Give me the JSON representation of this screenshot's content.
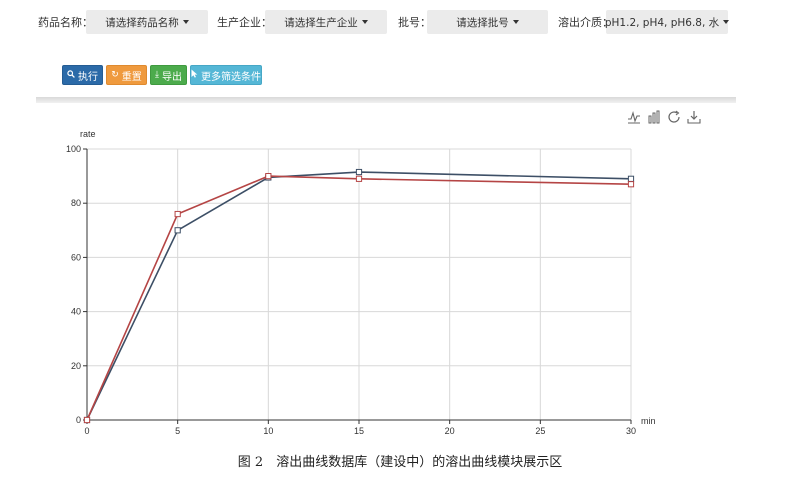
{
  "filters": {
    "drug": {
      "label": "药品名称：",
      "value": "请选择药品名称"
    },
    "company": {
      "label": "生产企业：",
      "value": "请选择生产企业"
    },
    "batch": {
      "label": "批号：",
      "value": "请选择批号"
    },
    "medium": {
      "label": "溶出介质：",
      "value": "pH1.2, pH4, pH6.8, 水"
    }
  },
  "buttons": {
    "execute": "执行",
    "reset": "重置",
    "export": "导出",
    "more_filters": "更多筛选条件"
  },
  "toolbox": {
    "icons": [
      "line-chart-icon",
      "bar-chart-icon",
      "refresh-icon",
      "download-icon"
    ]
  },
  "chart_data": {
    "type": "line",
    "title": "",
    "xlabel": "min",
    "ylabel": "rate",
    "xlim": [
      0,
      30
    ],
    "ylim": [
      0,
      100
    ],
    "x_ticks": [
      0,
      5,
      10,
      15,
      20,
      25,
      30
    ],
    "y_ticks": [
      0,
      20,
      40,
      60,
      80,
      100
    ],
    "grid": true,
    "series": [
      {
        "color": "#3d4f66",
        "x": [
          0,
          5,
          10,
          15,
          30
        ],
        "y": [
          0,
          70,
          89.5,
          91.5,
          89
        ]
      },
      {
        "color": "#b54545",
        "x": [
          0,
          5,
          10,
          15,
          30
        ],
        "y": [
          0,
          76,
          90,
          89,
          87
        ]
      }
    ]
  },
  "caption": "图 2　溶出曲线数据库（建设中）的溶出曲线模块展示区"
}
